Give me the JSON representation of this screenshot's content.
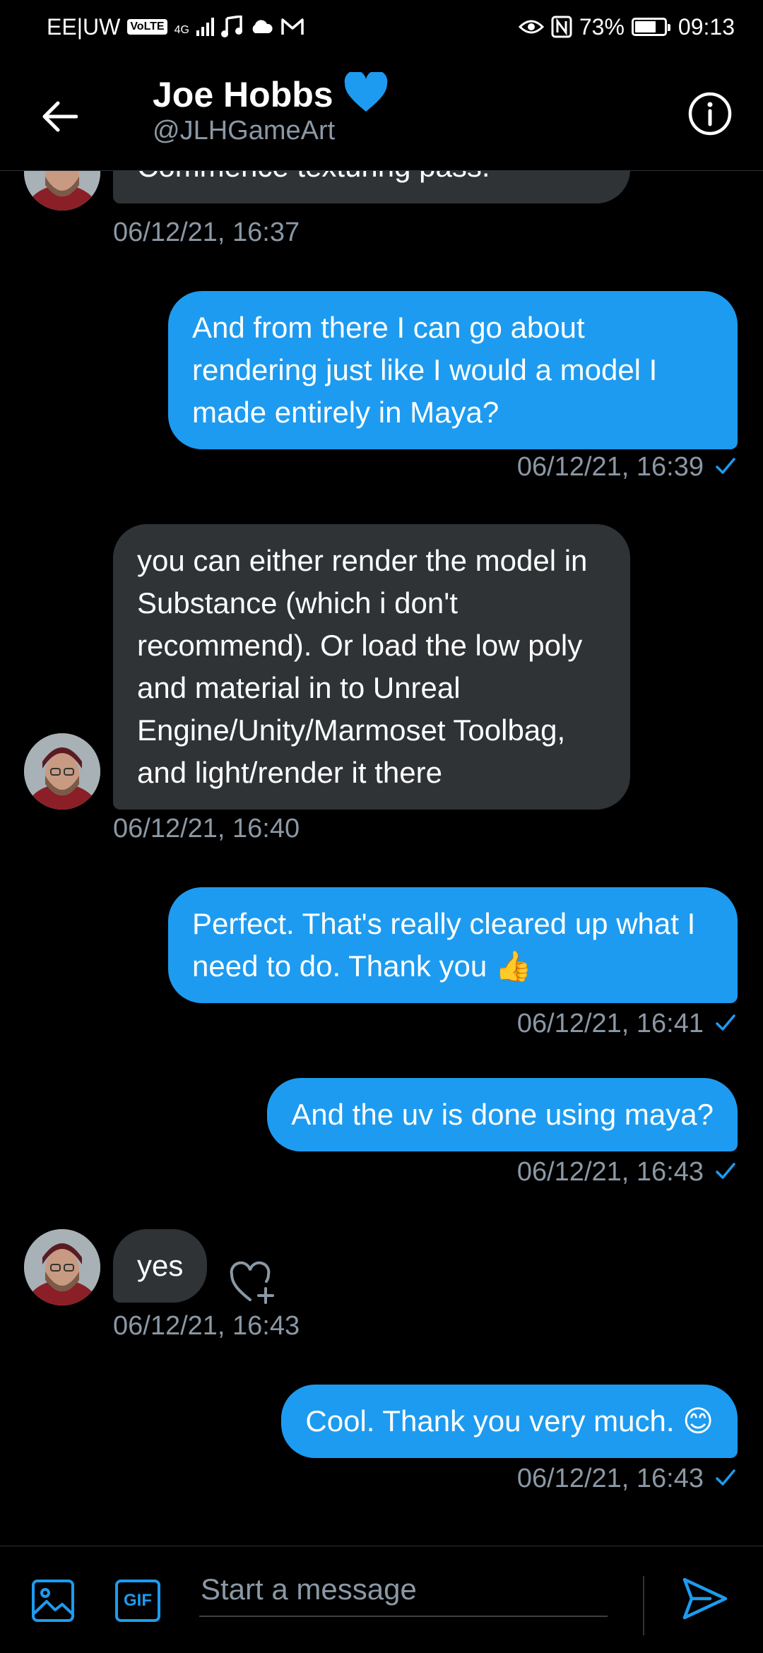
{
  "status_bar": {
    "carrier": "EE|UW",
    "volte": "VoLTE",
    "network": "4G",
    "battery": "73%",
    "time": "09:13",
    "icons": [
      "music-note-icon",
      "cloud-icon",
      "gmail-icon",
      "eye-icon",
      "nfc-icon",
      "battery-icon"
    ]
  },
  "header": {
    "name": "Joe Hobbs",
    "emoji": "💙",
    "handle": "@JLHGameArt"
  },
  "messages": [
    {
      "direction": "in",
      "text": "Commence texturing pass.",
      "timestamp": "06/12/21, 16:37"
    },
    {
      "direction": "out",
      "text": "And from there I can go about rendering just like I would a model I made entirely in Maya?",
      "timestamp": "06/12/21, 16:39"
    },
    {
      "direction": "in",
      "text": "you can either render the model in Substance (which i don't recommend). Or load the low poly and material in to Unreal Engine/Unity/Marmoset Toolbag, and light/render it there",
      "timestamp": "06/12/21, 16:40"
    },
    {
      "direction": "out",
      "text": "Perfect. That's really cleared up what I need to do. Thank you 👍",
      "timestamp": "06/12/21, 16:41"
    },
    {
      "direction": "out",
      "text": "And the uv is done using maya?",
      "timestamp": "06/12/21, 16:43"
    },
    {
      "direction": "in",
      "text": "yes",
      "timestamp": "06/12/21, 16:43"
    },
    {
      "direction": "out",
      "text": "Cool. Thank you very much. 😊",
      "timestamp": "06/12/21, 16:43"
    }
  ],
  "composer": {
    "placeholder": "Start a message",
    "gif_label": "GIF"
  },
  "colors": {
    "accent": "#1d9bf0",
    "incoming_bubble": "#2f3336",
    "muted_text": "#8b98a5",
    "background": "#000000"
  }
}
